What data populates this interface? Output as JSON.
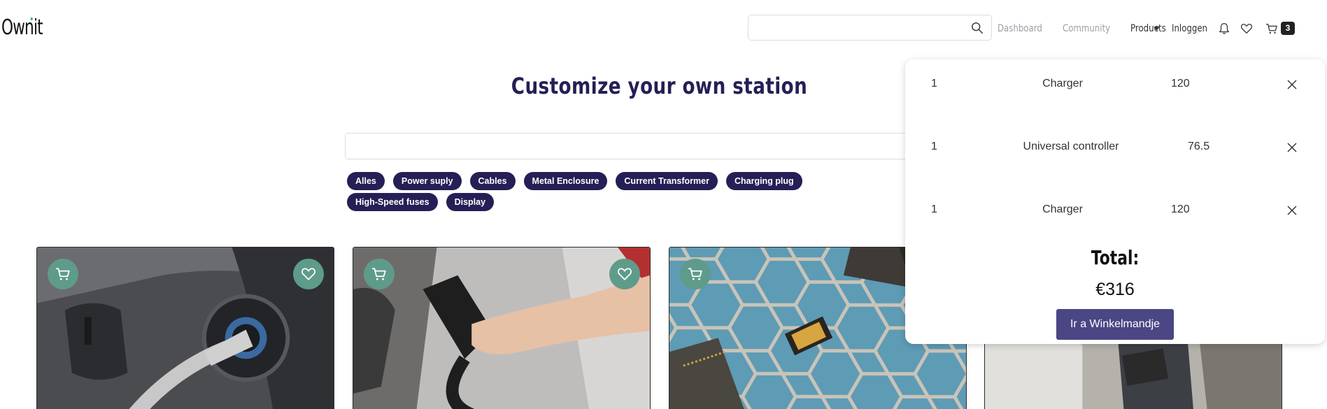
{
  "brand": {
    "logo_text": "Ownit"
  },
  "nav": {
    "search_placeholder": "",
    "links": {
      "dashboard": "Dashboard",
      "community": "Community",
      "products": "Products",
      "login": "Inloggen"
    },
    "cart_count": "3"
  },
  "main": {
    "title": "Customize your own station",
    "search_placeholder": "",
    "filters": [
      "Alles",
      "Power suply",
      "Cables",
      "Metal Enclosure",
      "Current Transformer",
      "Charging plug",
      "High-Speed fuses",
      "Display"
    ]
  },
  "products": [
    {
      "icons": [
        "cart-icon",
        "heart-icon"
      ]
    },
    {
      "icons": [
        "cart-icon",
        "heart-icon"
      ]
    },
    {
      "icons": [
        "cart-icon"
      ]
    },
    {
      "icons": []
    }
  ],
  "cart": {
    "items": [
      {
        "qty": "1",
        "name": "Charger",
        "price": "120"
      },
      {
        "qty": "1",
        "name": "Universal controller",
        "price": "76.5"
      },
      {
        "qty": "1",
        "name": "Charger",
        "price": "120"
      }
    ],
    "total_label": "Total:",
    "total_value": "€316",
    "checkout_label": "Ir a Winkelmandje"
  },
  "colors": {
    "primary": "#241f55",
    "accent": "#5f9b8a",
    "button": "#4b4684"
  }
}
